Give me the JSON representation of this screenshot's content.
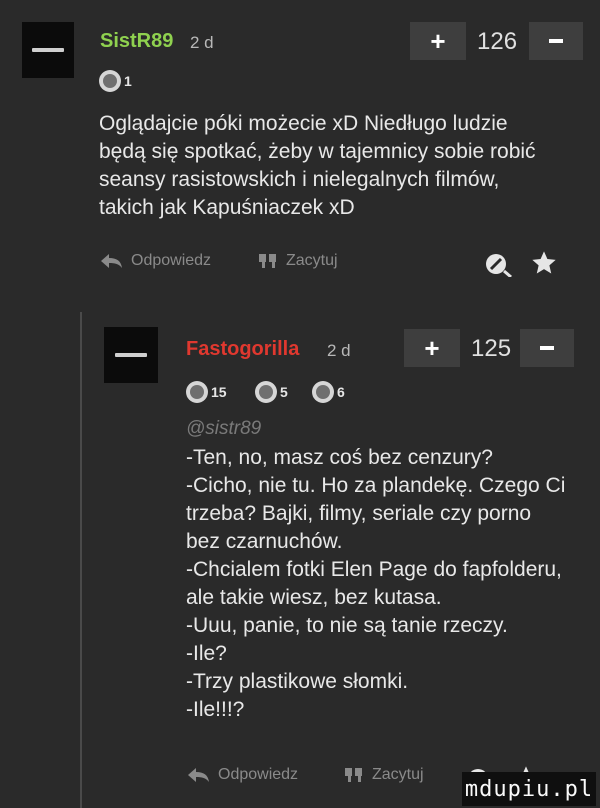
{
  "comments": [
    {
      "username": "SistR89",
      "username_color": "#8fd14f",
      "age": "2 d",
      "score": "126",
      "plus_label": "+",
      "badges": [
        {
          "count": "1"
        }
      ],
      "lines": [
        "Oglądajcie póki możecie xD Niedługo ludzie",
        "będą się spotkać, żeby w tajemnicy sobie robić",
        "seansy rasistowskich i nielegalnych filmów,",
        "takich jak Kapuśniaczek xD"
      ],
      "reply_label": "Odpowiedz",
      "quote_label": "Zacytuj"
    },
    {
      "username": "Fastogorilla",
      "username_color": "#e0382f",
      "age": "2 d",
      "score": "125",
      "plus_label": "+",
      "badges": [
        {
          "count": "15"
        },
        {
          "count": "5"
        },
        {
          "count": "6"
        }
      ],
      "mention": "@sistr89",
      "lines": [
        "-Ten, no, masz coś bez cenzury?",
        "-Cicho, nie tu. Ho za plandekę. Czego Ci",
        "trzeba? Bajki, filmy, seriale czy porno",
        "bez czarnuchów.",
        "-Chcialem fotki Elen Page do fapfolderu,",
        "ale takie wiesz, bez kutasa.",
        "-Uuu, panie, to nie są tanie rzeczy.",
        "-Ile?",
        "-Trzy plastikowe słomki.",
        "-Ile!!!?"
      ],
      "reply_label": "Odpowiedz",
      "quote_label": "Zacytuj"
    }
  ],
  "watermark": "mdupiu.pl"
}
